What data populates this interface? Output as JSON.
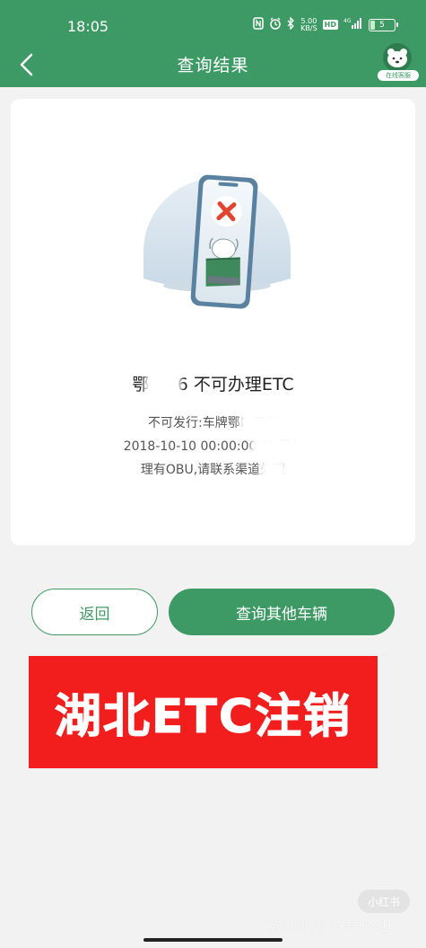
{
  "status_bar": {
    "time": "18:05",
    "net_speed": "5.00",
    "net_unit": "KB/S",
    "hd": "HD",
    "network": "4G",
    "battery": "5"
  },
  "nav": {
    "title": "查询结果",
    "cs_label": "在线客服"
  },
  "result": {
    "title": "鄂R 56 不可办理ETC",
    "message_line1": "不可发行:车牌鄂R 已在",
    "message_line2": "2018-10-10 00:00:00,在 行办",
    "message_line3": "理有OBU,请联系渠道处理"
  },
  "buttons": {
    "return_label": "返回",
    "query_other_label": "查询其他车辆"
  },
  "banner": {
    "text": "湖北ETC注销"
  },
  "watermark": {
    "logo": "小红书",
    "id_text": "我的小红书号:1968660941"
  },
  "colors": {
    "primary": "#3e9a65",
    "banner": "#f21d1d",
    "error_icon": "#e0452f"
  }
}
